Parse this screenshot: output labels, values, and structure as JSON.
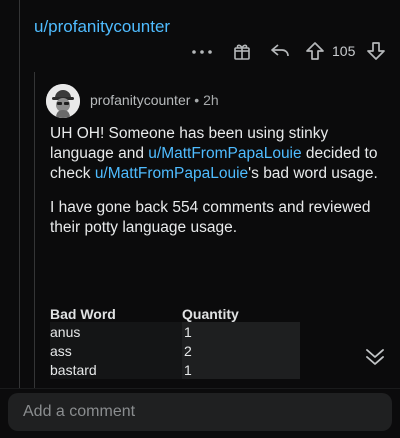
{
  "parent_comment": {
    "username": "u/profanitycounter"
  },
  "actions": {
    "more_icon": "more-horizontal-icon",
    "award_icon": "award-icon",
    "reply_icon": "reply-icon",
    "upvote_icon": "upvote-arrow-icon",
    "votes": "105",
    "downvote_icon": "downvote-arrow-icon"
  },
  "comment": {
    "author": "profanitycounter",
    "separator": " • ",
    "age": "2h",
    "p1_a": "UH OH! Someone has been using stinky language and ",
    "p1_link": "u/MattFromPapaLouie",
    "p1_b": " decided to check ",
    "p1_link2": "u/MattFromPapaLouie",
    "p1_c": "'s bad word usage.",
    "p2": "I have gone back 554 comments and reviewed their potty language usage."
  },
  "table": {
    "headers": [
      "Bad Word",
      "Quantity"
    ],
    "rows": [
      {
        "word": "anus",
        "qty": "1"
      },
      {
        "word": "ass",
        "qty": "2"
      },
      {
        "word": "bastard",
        "qty": "1"
      }
    ]
  },
  "composer": {
    "placeholder": "Add a comment"
  },
  "colors": {
    "link": "#4fbcff",
    "background": "#0b0b0c",
    "composer": "#1f2021"
  }
}
